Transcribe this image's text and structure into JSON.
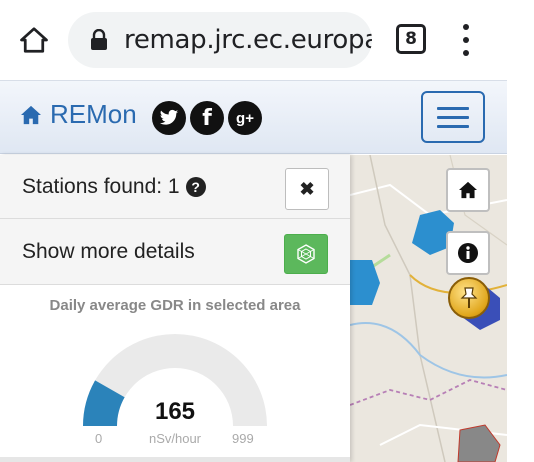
{
  "browser": {
    "url": "remap.jrc.ec.europa.eu",
    "tab_count": "8",
    "icons": [
      "home-icon",
      "lock-icon",
      "tabs-count-icon",
      "more-vert-icon"
    ]
  },
  "navbar": {
    "brand_label": "REMon",
    "brand_color": "#2a6ab0",
    "social": [
      "twitter-icon",
      "facebook-icon",
      "google-plus-icon"
    ],
    "google_plus_label": "g+"
  },
  "panel": {
    "stations_found": "Stations found: 1",
    "help_glyph": "?",
    "close_glyph": "✖",
    "show_more_details": "Show more details",
    "details_button_color": "#5cb85c"
  },
  "gauge": {
    "title": "Daily average GDR in selected area",
    "value": 165,
    "value_label": "165",
    "unit": "nSv/hour",
    "min": 0,
    "min_label": "0",
    "max": 999,
    "max_label": "999",
    "fill_color": "#2b83ba",
    "track_color": "#eaeaea"
  },
  "map": {
    "buttons": [
      "home-map-icon",
      "info-map-icon"
    ],
    "hex_colors": [
      "#2c8fcf",
      "#3a4fb8",
      "#888888"
    ]
  }
}
